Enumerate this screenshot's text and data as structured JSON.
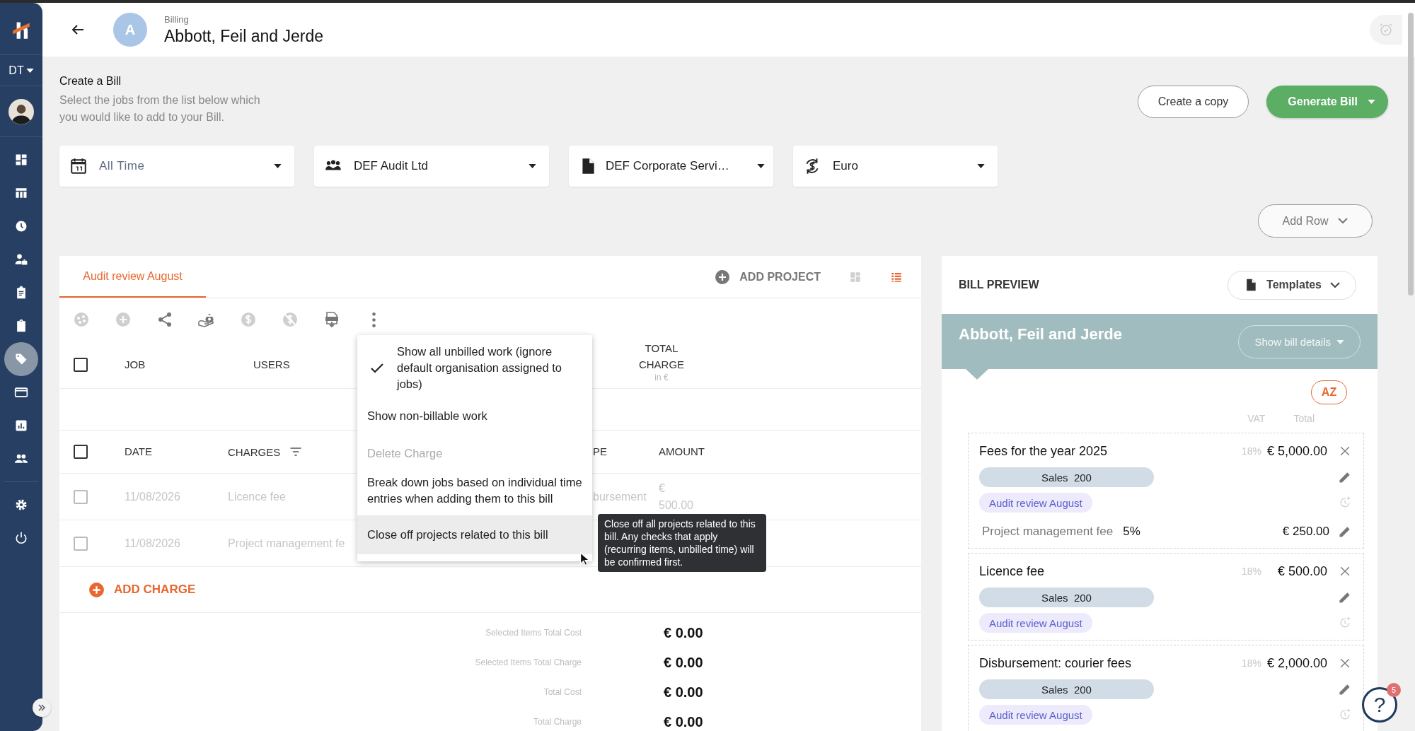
{
  "sidebar": {
    "org": "DT",
    "nav": [
      {
        "kind": "dashboard",
        "selected": false
      },
      {
        "kind": "table",
        "selected": false
      },
      {
        "kind": "clock",
        "selected": false
      },
      {
        "kind": "user-case",
        "selected": false
      },
      {
        "kind": "clipboard-list",
        "selected": false
      },
      {
        "kind": "clipboard",
        "selected": false
      },
      {
        "kind": "tag",
        "selected": true
      },
      {
        "kind": "card",
        "selected": false
      },
      {
        "kind": "chart",
        "selected": false
      },
      {
        "kind": "people",
        "selected": false
      }
    ],
    "system": [
      {
        "kind": "settings",
        "selected": false
      },
      {
        "kind": "power",
        "selected": false
      }
    ]
  },
  "header": {
    "avatar_letter": "A",
    "breadcrumb": "Billing",
    "title": "Abbott, Feil and Jerde"
  },
  "intro": {
    "title": "Create a Bill",
    "description": "Select the jobs from the list below which you would like to add to your Bill."
  },
  "actions": [
    {
      "kind": "outline",
      "label": "Create a copy"
    },
    {
      "kind": "primary",
      "label": "Generate Bill"
    }
  ],
  "filters": [
    {
      "kind": "calendar",
      "value": "All Time"
    },
    {
      "kind": "team",
      "value": "DEF Audit Ltd"
    },
    {
      "kind": "document",
      "value": "DEF Corporate Servi…"
    },
    {
      "kind": "currency",
      "value": "Euro"
    }
  ],
  "add_row": "Add Row",
  "project": {
    "tabs": [
      {
        "label": "Audit review August",
        "selected": true
      }
    ],
    "add_project": "ADD PROJECT",
    "views": [
      {
        "kind": "grid",
        "selected": false
      },
      {
        "kind": "list",
        "selected": true
      }
    ],
    "toolbar": [
      {
        "kind": "palette",
        "disabled": true
      },
      {
        "kind": "plus",
        "disabled": true
      },
      {
        "kind": "share",
        "disabled": false
      },
      {
        "kind": "money",
        "disabled": false
      },
      {
        "kind": "dollar",
        "disabled": true
      },
      {
        "kind": "no-dollar",
        "disabled": true
      },
      {
        "kind": "csv",
        "disabled": false
      },
      {
        "kind": "more",
        "disabled": false
      }
    ],
    "job_table": {
      "checked": false,
      "columns": [
        {
          "label": "JOB"
        },
        {
          "label": "USERS"
        },
        {
          "label": "TOTAL CHARGE",
          "unit": "in €"
        }
      ]
    },
    "charge_table": {
      "checked": false,
      "columns": [
        {
          "label": "DATE",
          "filter": false
        },
        {
          "label": "CHARGES",
          "filter": true
        },
        {
          "label": "PE",
          "filter": false
        },
        {
          "label": "AMOUNT",
          "filter": false
        }
      ],
      "rows": [
        {
          "checked": false,
          "disabled": true,
          "date": "11/08/2026",
          "charge": "Licence fee",
          "type": "bursement",
          "amount": "€ 500.00"
        },
        {
          "checked": false,
          "disabled": true,
          "date": "11/08/2026",
          "charge": "Project management fe"
        }
      ]
    },
    "add_charge": "ADD CHARGE",
    "totals": [
      {
        "label": "Selected Items Total Cost",
        "value": "€ 0.00"
      },
      {
        "label": "Selected Items Total Charge",
        "value": "€ 0.00"
      },
      {
        "label": "Total Cost",
        "value": "€ 0.00"
      },
      {
        "label": "Total Charge",
        "value": "€ 0.00"
      }
    ]
  },
  "menu": {
    "items": [
      {
        "label": "Show all unbilled work (ignore default organisation assigned to jobs)",
        "checked": true,
        "disabled": false,
        "highlighted": false
      },
      {
        "label": "Show non-billable work",
        "checked": false,
        "disabled": false,
        "highlighted": false
      },
      {
        "label": "Delete Charge",
        "checked": false,
        "disabled": true,
        "highlighted": false
      },
      {
        "label": "Break down jobs based on individual time entries when adding them to this bill",
        "checked": false,
        "disabled": false,
        "highlighted": false
      },
      {
        "label": "Close off projects related to this bill",
        "checked": false,
        "disabled": false,
        "highlighted": true
      }
    ]
  },
  "tooltip": "Close off all projects related to this bill. Any checks that apply (recurring items, unbilled time) will be confirmed first.",
  "preview": {
    "title": "BILL PREVIEW",
    "templates": "Templates",
    "client": "Abbott, Feil and Jerde",
    "details_button": "Show bill details",
    "sort_label": "AZ",
    "columns": [
      "VAT",
      "Total"
    ],
    "items": [
      {
        "name": "Fees for the year 2025",
        "vat": "18%",
        "total": "€ 5,000.00",
        "account": "Sales  200",
        "project": "Audit review August",
        "extras": [
          {
            "name": "Project management fee",
            "rate": "5%",
            "total": "€ 250.00"
          }
        ]
      },
      {
        "name": "Licence fee",
        "vat": "18%",
        "total": "€ 500.00",
        "account": "Sales  200",
        "project": "Audit review August"
      },
      {
        "name": "Disbursement: courier fees",
        "vat": "18%",
        "total": "€ 2,000.00",
        "account": "Sales  200",
        "project": "Audit review August"
      }
    ]
  },
  "help": {
    "label": "?",
    "badge": "5"
  }
}
